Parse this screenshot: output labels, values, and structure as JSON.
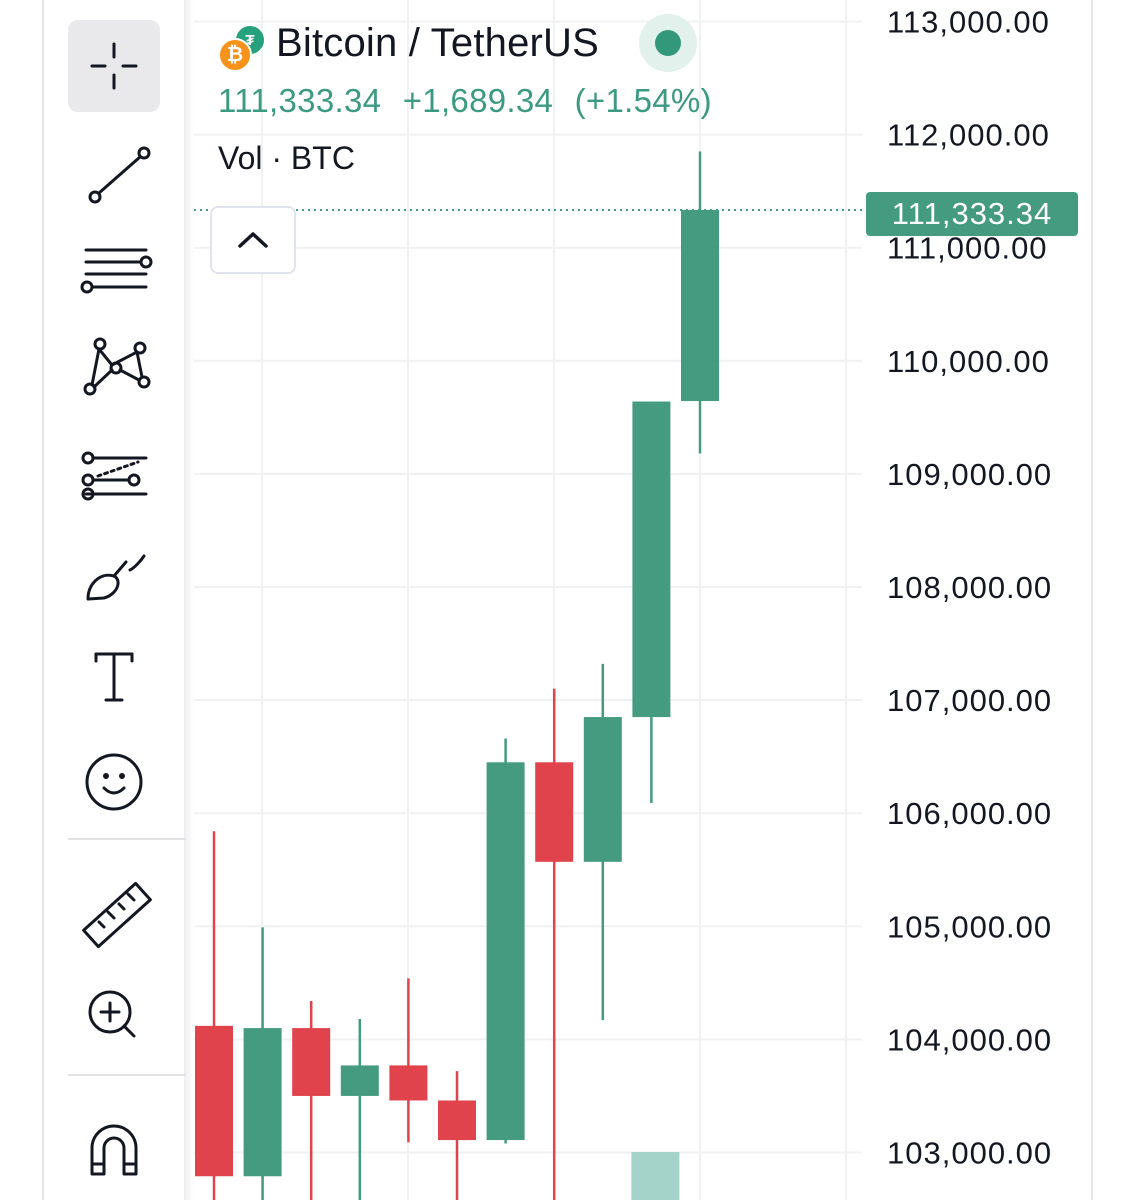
{
  "legend": {
    "symbol_title": "Bitcoin / TetherUS",
    "base_icon": "bitcoin-coin-icon",
    "base_icon_glyph": "₿",
    "quote_icon": "tether-coin-icon",
    "quote_icon_glyph": "₮",
    "last_price": "111,333.34",
    "change": "+1,689.34",
    "change_pct": "(+1.54%)",
    "volume_label": "Vol · BTC",
    "status_icon": "market-open-dot-icon"
  },
  "toolbar": {
    "tools": [
      {
        "name": "crosshair-tool",
        "icon": "crosshair-icon",
        "active": true
      },
      {
        "name": "trend-line-tool",
        "icon": "trend-line-icon",
        "active": false
      },
      {
        "name": "fib-retracement-tool",
        "icon": "fib-levels-icon",
        "active": false
      },
      {
        "name": "xabcd-pattern-tool",
        "icon": "pattern-icon",
        "active": false
      },
      {
        "name": "projection-tool",
        "icon": "forecast-icon",
        "active": false
      },
      {
        "name": "brush-tool",
        "icon": "brush-icon",
        "active": false
      },
      {
        "name": "text-tool",
        "icon": "text-icon",
        "active": false
      },
      {
        "name": "emoji-tool",
        "icon": "smiley-icon",
        "active": false
      },
      {
        "name": "measure-tool",
        "icon": "ruler-icon",
        "active": false
      },
      {
        "name": "zoom-in-tool",
        "icon": "zoom-in-icon",
        "active": false
      },
      {
        "name": "magnet-tool",
        "icon": "magnet-icon",
        "active": false
      }
    ],
    "collapse_icon": "chevron-up-icon"
  },
  "price_badge": "111,333.34",
  "colors": {
    "up": "#449b80",
    "down": "#e0434c",
    "grid": "#f0f1f3",
    "volume_up": "#a3d3c9",
    "price_line": "#449b80",
    "text": "#131722"
  },
  "chart_data": {
    "type": "candlestick",
    "y_ticks": [
      "113,000.00",
      "112,000.00",
      "111,000.00",
      "110,000.00",
      "109,000.00",
      "108,000.00",
      "107,000.00",
      "106,000.00",
      "105,000.00",
      "104,000.00",
      "103,000.00"
    ],
    "y_tick_values": [
      113000,
      112000,
      111000,
      110000,
      109000,
      108000,
      107000,
      106000,
      105000,
      104000,
      103000
    ],
    "ylim": [
      102580,
      113190
    ],
    "last_price": 111333.34,
    "candles": [
      {
        "open": 104120,
        "high": 105840,
        "low": 102500,
        "close": 102790
      },
      {
        "open": 102790,
        "high": 104990,
        "low": 102500,
        "close": 104100
      },
      {
        "open": 104100,
        "high": 104340,
        "low": 102500,
        "close": 103500
      },
      {
        "open": 103500,
        "high": 104180,
        "low": 102500,
        "close": 103770
      },
      {
        "open": 103770,
        "high": 104540,
        "low": 103090,
        "close": 103460
      },
      {
        "open": 103460,
        "high": 103720,
        "low": 102500,
        "close": 103110
      },
      {
        "open": 103110,
        "high": 106660,
        "low": 103080,
        "close": 106450
      },
      {
        "open": 106450,
        "high": 107100,
        "low": 102500,
        "close": 105570
      },
      {
        "open": 105570,
        "high": 107320,
        "low": 104170,
        "close": 106850
      },
      {
        "open": 106850,
        "high": 108780,
        "low": 106090,
        "close": 109640
      },
      {
        "open": 109644,
        "high": 111850,
        "low": 109180,
        "close": 111333.34
      }
    ],
    "volume": [
      {
        "index": 9,
        "direction": "up"
      }
    ]
  }
}
